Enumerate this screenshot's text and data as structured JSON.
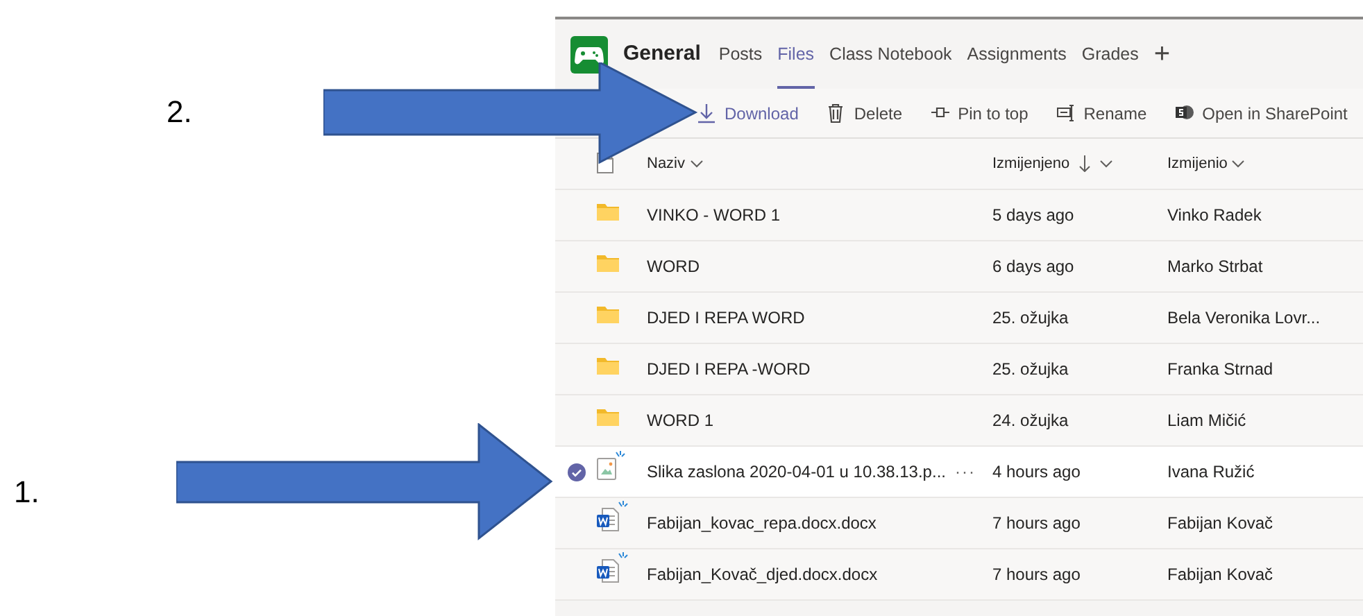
{
  "annotations": [
    {
      "label": "2."
    },
    {
      "label": "1."
    }
  ],
  "channel": {
    "title": "General",
    "tabs": [
      {
        "label": "Posts",
        "selected": false
      },
      {
        "label": "Files",
        "selected": true
      },
      {
        "label": "Class Notebook",
        "selected": false
      },
      {
        "label": "Assignments",
        "selected": false
      },
      {
        "label": "Grades",
        "selected": false
      }
    ],
    "add_tab": "+"
  },
  "toolbar": [
    {
      "kind": "download",
      "label": "Download"
    },
    {
      "kind": "delete",
      "label": "Delete"
    },
    {
      "kind": "pin",
      "label": "Pin to top"
    },
    {
      "kind": "rename",
      "label": "Rename"
    },
    {
      "kind": "sharepoint",
      "label": "Open in SharePoint"
    }
  ],
  "table": {
    "columns": [
      {
        "label": "Naziv",
        "sorted": false
      },
      {
        "label": "Izmijenjeno",
        "sorted": true
      },
      {
        "label": "Izmijenio",
        "sorted": false
      }
    ],
    "rows": [
      {
        "kind": "folder",
        "name": "VINKO - WORD 1",
        "modified": "5 days ago",
        "modified_by": "Vinko Radek",
        "is_new": false,
        "selected": false
      },
      {
        "kind": "folder",
        "name": "WORD",
        "modified": "6 days ago",
        "modified_by": "Marko Strbat",
        "is_new": false,
        "selected": false
      },
      {
        "kind": "folder",
        "name": "DJED I REPA WORD",
        "modified": "25. ožujka",
        "modified_by": "Bela Veronika Lovr...",
        "is_new": false,
        "selected": false
      },
      {
        "kind": "folder",
        "name": "DJED I REPA -WORD",
        "modified": "25. ožujka",
        "modified_by": "Franka Strnad",
        "is_new": false,
        "selected": false
      },
      {
        "kind": "folder",
        "name": "WORD 1",
        "modified": "24. ožujka",
        "modified_by": "Liam Mičić",
        "is_new": false,
        "selected": false
      },
      {
        "kind": "image",
        "name": "Slika zaslona 2020-04-01 u 10.38.13.p...",
        "more": "···",
        "modified": "4 hours ago",
        "modified_by": "Ivana Ružić",
        "is_new": true,
        "selected": true
      },
      {
        "kind": "word",
        "name": "Fabijan_kovac_repa.docx.docx",
        "modified": "7 hours ago",
        "modified_by": "Fabijan Kovač",
        "is_new": true,
        "selected": false
      },
      {
        "kind": "word",
        "name": "Fabijan_Kovač_djed.docx.docx",
        "modified": "7 hours ago",
        "modified_by": "Fabijan Kovač",
        "is_new": true,
        "selected": false
      }
    ]
  }
}
